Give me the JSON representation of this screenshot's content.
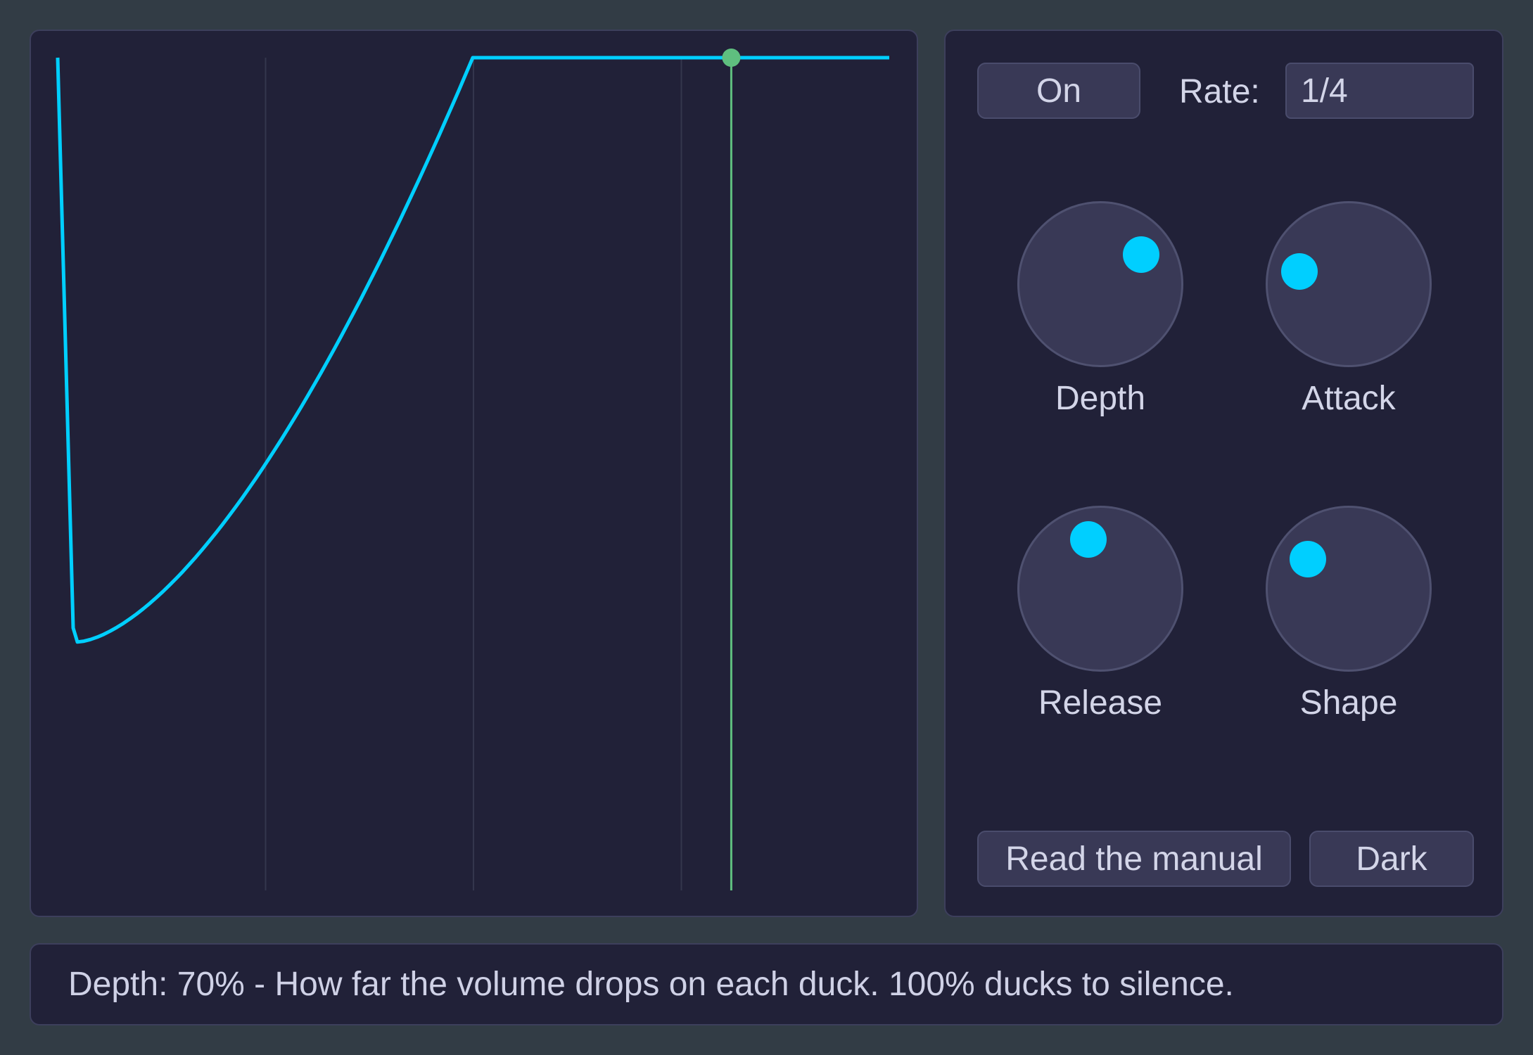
{
  "controls": {
    "power_label": "On",
    "rate_label": "Rate:",
    "rate_value": "1/4",
    "manual_label": "Read the manual",
    "theme_label": "Dark"
  },
  "knobs": [
    {
      "label": "Depth",
      "value_percent": 70
    },
    {
      "label": "Attack",
      "value_percent": 22
    },
    {
      "label": "Release",
      "value_percent": 45
    },
    {
      "label": "Shape",
      "value_percent": 30
    }
  ],
  "info": {
    "text": "Depth: 70% - How far the volume drops on each duck. 100% ducks to silence."
  },
  "envelope": {
    "depth_fraction": 0.7,
    "playhead_fraction": 0.81,
    "grid_divisions": 4
  },
  "colors": {
    "background": "#323c45",
    "panel": "#212138",
    "accent": "#00cfff",
    "playhead": "#5fbf7f",
    "grid": "#34364d"
  }
}
